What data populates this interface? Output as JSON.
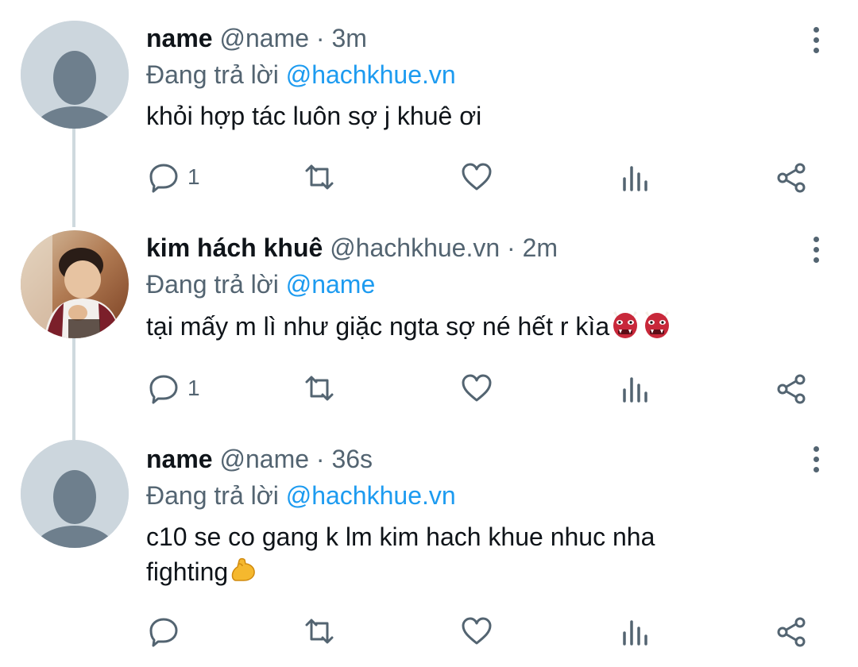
{
  "tweets": [
    {
      "author_name": "name",
      "handle": "@name",
      "time": "3m",
      "reply_prefix": "Đang trả lời",
      "reply_to": "@hachkhue.vn",
      "text": "khỏi hợp tác luôn sợ j khuê ơi",
      "reply_count": "1",
      "avatar": "default-avatar-icon"
    },
    {
      "author_name": "kim hách khuê",
      "handle": "@hachkhue.vn",
      "time": "2m",
      "reply_prefix": "Đang trả lời",
      "reply_to": "@name",
      "text": "tại mấy m lì như giặc ngta sợ né hết r kìa",
      "emoji": [
        "ogre-emoji-icon",
        "ogre-emoji-icon"
      ],
      "reply_count": "1",
      "avatar": "child-photo-avatar"
    },
    {
      "author_name": "name",
      "handle": "@name",
      "time": "36s",
      "reply_prefix": "Đang trả lời",
      "reply_to": "@hachkhue.vn",
      "text_line1": "c10 se co gang k lm kim hach khue nhuc nha",
      "text_line2": "fighting",
      "emoji": [
        "flexed-biceps-emoji-icon"
      ],
      "reply_count": "",
      "avatar": "default-avatar-icon"
    }
  ],
  "separator": "·",
  "colors": {
    "text": "#0f1419",
    "secondary": "#536471",
    "accent": "#1d9bf0",
    "thread_line": "#cfd9de",
    "avatar_bg": "#ccd6dd",
    "avatar_fg": "#6e7f8d"
  }
}
